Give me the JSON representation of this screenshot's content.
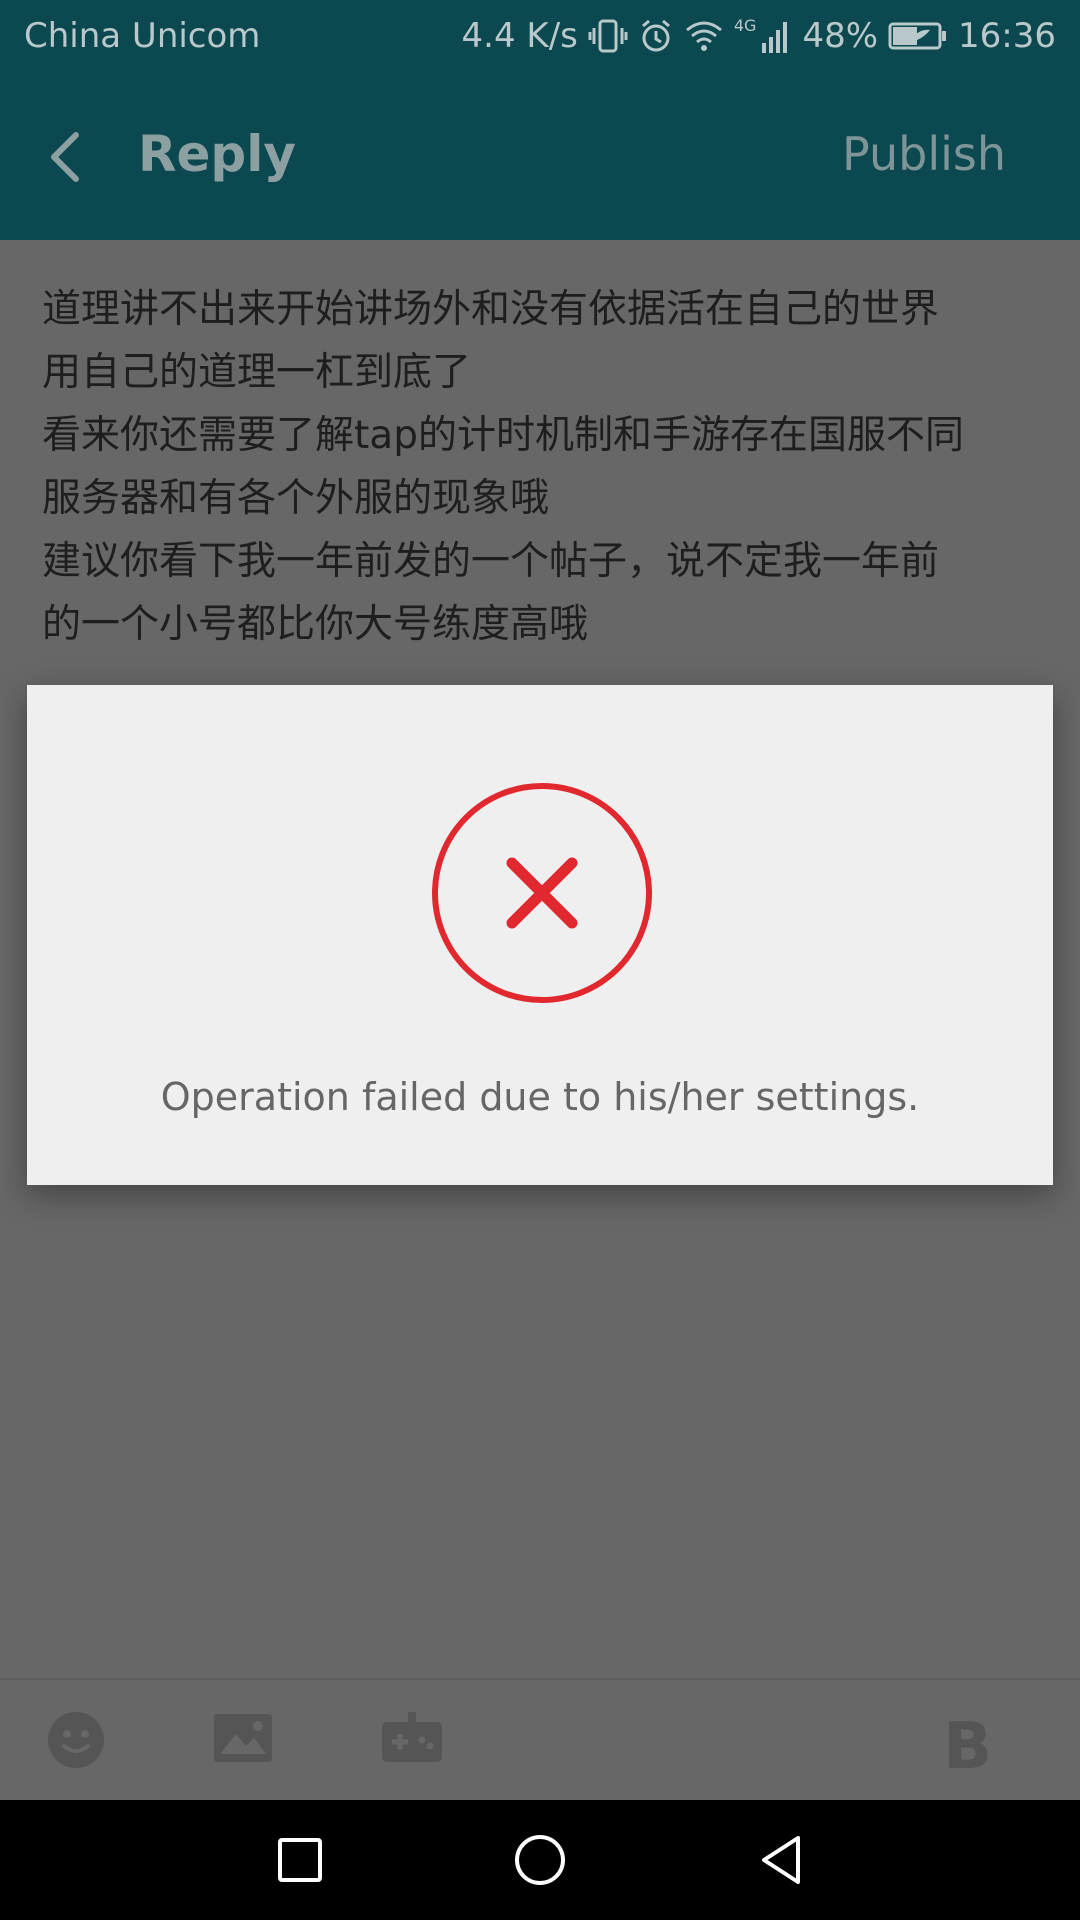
{
  "status_bar": {
    "carrier": "China Unicom",
    "speed": "4.4 K/s",
    "network": "4G",
    "battery": "48%",
    "time": "16:36"
  },
  "app_bar": {
    "title": "Reply",
    "publish_label": "Publish"
  },
  "content": {
    "text": "道理讲不出来开始讲场外和没有依据活在自己的世界\n用自己的道理一杠到底了\n看来你还需要了解tap的计时机制和手游存在国服不同\n服务器和有各个外服的现象哦\n建议你看下我一年前发的一个帖子，说不定我一年前\n的一个小号都比你大号练度高哦"
  },
  "dialog": {
    "icon": "error-circle-x-icon",
    "message": "Operation failed due to his/her settings.",
    "accent_color": "#e0282e"
  },
  "toolbar": {
    "bold_label": "B"
  }
}
